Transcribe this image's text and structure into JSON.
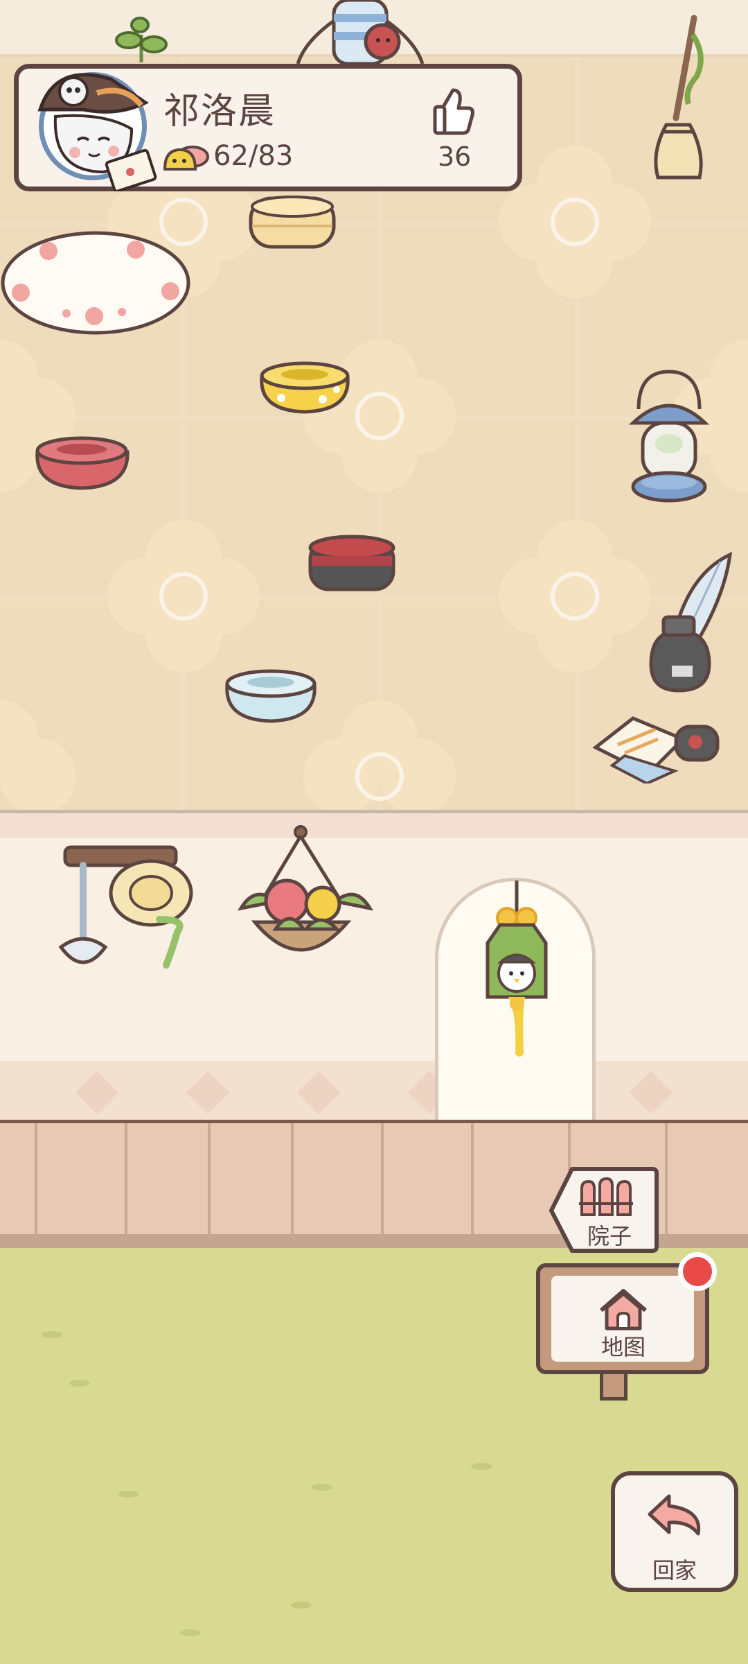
{
  "player": {
    "name": "祁洛晨",
    "friendship": "62/83",
    "likes": "36"
  },
  "buttons": {
    "yard_label": "院子",
    "map_label": "地图",
    "home_label": "回家"
  },
  "map_button": {
    "has_notification": true
  },
  "colors": {
    "outline": "#5c4440",
    "notification": "#e84a4a",
    "lawn": "#d7da90",
    "floor": "#fbf3e7"
  }
}
